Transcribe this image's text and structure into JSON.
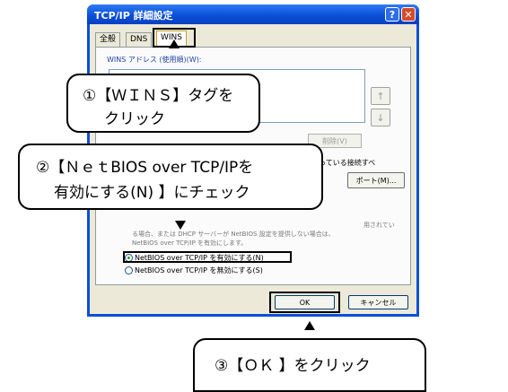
{
  "window": {
    "title": "TCP/IP 詳細設定",
    "help_glyph": "?",
    "close_glyph": "✕"
  },
  "tabs": [
    {
      "label": "全般",
      "active": false
    },
    {
      "label": "DNS",
      "active": false
    },
    {
      "label": "WINS",
      "active": true
    }
  ],
  "wins": {
    "group_label": "WINS アドレス (使用順)(W):",
    "up_glyph": "↑",
    "down_glyph": "↓",
    "delete_label": "削除(V)",
    "info_text": "LMHOSTS の参照が有効になっている場合、TCP/IP が使用可能になっている接続すべ",
    "import_label": "ポート(M)...",
    "netbios_text_1": "用されてい",
    "netbios_text_2": "る場合、または DHCP サーバーが NetBIOS 設定を提供しない場合は、",
    "netbios_text_3": "NetBIOS over TCP/IP を有効にします。",
    "radio_enable": "NetBIOS over TCP/IP を有効にする(N)",
    "radio_disable": "NetBIOS over TCP/IP を無効にする(S)",
    "radio_enable_selected": true
  },
  "footer": {
    "ok_label": "OK",
    "cancel_label": "キャンセル"
  },
  "callouts": {
    "c1_line1": "①【ＷＩＮＳ】タグを",
    "c1_line2": "クリック",
    "c2_line1": "②【ＮｅｔBIOS over TCP/IPを",
    "c2_line2": "有効にする(N) 】にチェック",
    "c3_line1": "③【ＯＫ 】をクリック"
  },
  "colors": {
    "titlebar": "#0a4fd8",
    "dialog_bg": "#ece9d8",
    "close_button": "#d64b2a",
    "radio_dot": "#2a9b2a"
  }
}
